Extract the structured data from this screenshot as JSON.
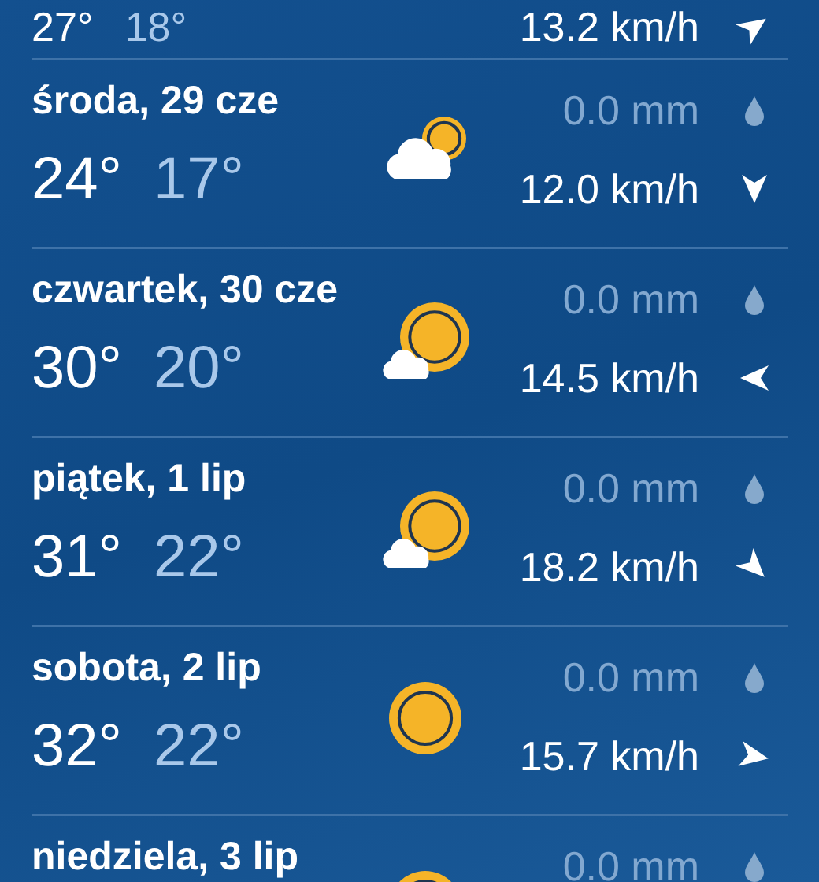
{
  "days": [
    {
      "high": "27°",
      "low": "18°",
      "wind": "13.2 km/h",
      "kind": "none"
    },
    {
      "day": "środa, 29 cze",
      "high": "24°",
      "low": "17°",
      "rain": "0.0 mm",
      "wind": "12.0 km/h",
      "kind": "cloudy"
    },
    {
      "day": "czwartek, 30 cze",
      "high": "30°",
      "low": "20°",
      "rain": "0.0 mm",
      "wind": "14.5 km/h",
      "kind": "mostly-sunny"
    },
    {
      "day": "piątek, 1 lip",
      "high": "31°",
      "low": "22°",
      "rain": "0.0 mm",
      "wind": "18.2 km/h",
      "kind": "mostly-sunny"
    },
    {
      "day": "sobota, 2 lip",
      "high": "32°",
      "low": "22°",
      "rain": "0.0 mm",
      "wind": "15.7 km/h",
      "kind": "sunny"
    },
    {
      "day": "niedziela, 3 lip",
      "rain": "0.0 mm",
      "kind": "sunny"
    }
  ]
}
